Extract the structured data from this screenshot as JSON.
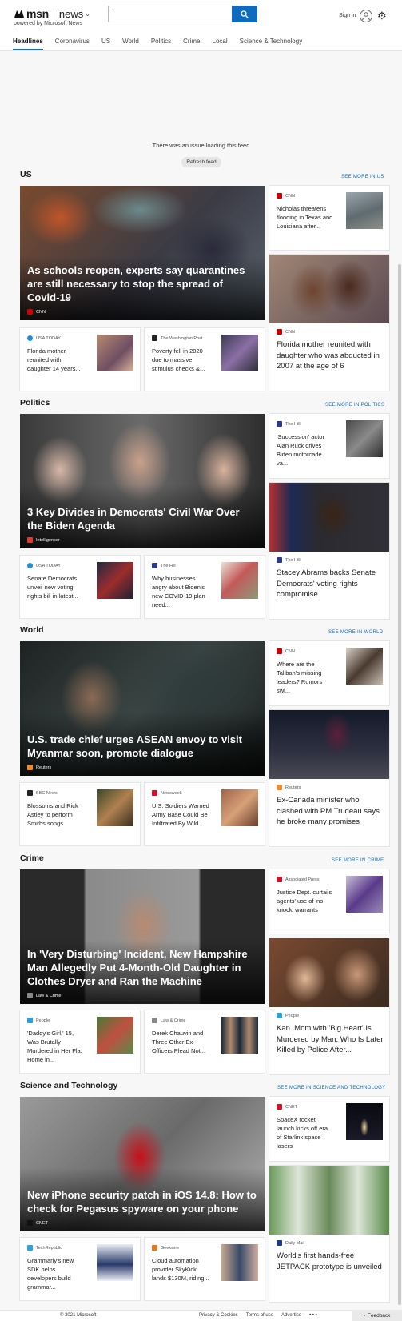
{
  "header": {
    "brand": "msn",
    "section": "news",
    "powered_by": "powered by Microsoft News",
    "search_placeholder": "",
    "signin_label": "Sign in"
  },
  "nav": {
    "tabs": [
      "Headlines",
      "Coronavirus",
      "US",
      "World",
      "Politics",
      "Crime",
      "Local",
      "Science & Technology"
    ],
    "active": "Headlines"
  },
  "feed": {
    "error_message": "There was an issue loading this feed",
    "refresh_label": "Refresh feed"
  },
  "sections": {
    "us": {
      "title": "US",
      "see_more": "SEE MORE IN US",
      "hero": {
        "title": "As schools reopen, experts say quarantines are still necessary to stop the spread of Covid-19",
        "source": "CNN"
      },
      "small1": {
        "source": "USA TODAY",
        "title": "Florida mother reunited with daughter 14 years..."
      },
      "small2": {
        "source": "The Washington Post",
        "title": "Poverty fell in 2020 due to massive stimulus checks &..."
      },
      "side1": {
        "source": "CNN",
        "title": "Nicholas threatens flooding in Texas and Louisiana after..."
      },
      "tall": {
        "source": "CNN",
        "title": "Florida mother reunited with daughter who was abducted in 2007 at the age of 6"
      }
    },
    "politics": {
      "title": "Politics",
      "see_more": "SEE MORE IN POLITICS",
      "hero": {
        "title": "3 Key Divides in Democrats' Civil War Over the Biden Agenda",
        "source": "Intelligencer"
      },
      "small1": {
        "source": "USA TODAY",
        "title": "Senate Democrats unveil new voting rights bill in latest..."
      },
      "small2": {
        "source": "The Hill",
        "title": "Why businesses angry about Biden's new COVID-19 plan need..."
      },
      "side1": {
        "source": "The Hill",
        "title": "'Succession' actor Alan Ruck drives Biden motorcade va..."
      },
      "tall": {
        "source": "The Hill",
        "title": "Stacey Abrams backs Senate Democrats' voting rights compromise"
      }
    },
    "world": {
      "title": "World",
      "see_more": "SEE MORE IN WORLD",
      "hero": {
        "title": "U.S. trade chief urges ASEAN envoy to visit Myanmar soon, promote dialogue",
        "source": "Reuters"
      },
      "small1": {
        "source": "BBC News",
        "title": "Blossoms and Rick Astley to perform Smiths songs"
      },
      "small2": {
        "source": "Newsweek",
        "title": "U.S. Soldiers Warned Army Base Could Be Infiltrated By Wild..."
      },
      "side1": {
        "source": "CNN",
        "title": "Where are the Taliban's missing leaders? Rumors swi..."
      },
      "tall": {
        "source": "Reuters",
        "title": "Ex-Canada minister who clashed with PM Trudeau says he broke many promises"
      }
    },
    "crime": {
      "title": "Crime",
      "see_more": "SEE MORE IN CRIME",
      "hero": {
        "title": "In 'Very Disturbing' Incident, New Hampshire Man Allegedly Put 4-Month-Old Daughter in Clothes Dryer and Ran the Machine",
        "source": "Law & Crime"
      },
      "small1": {
        "source": "People",
        "title": "'Daddy's Girl,' 15, Was Brutally Murdered in Her Fla. Home in..."
      },
      "small2": {
        "source": "Law & Crime",
        "title": "Derek Chauvin and Three Other Ex-Officers Plead Not..."
      },
      "side1": {
        "source": "Associated Press",
        "title": "Justice Dept. curtails agents' use of 'no-knock' warrants"
      },
      "tall": {
        "source": "People",
        "title": "Kan. Mom with 'Big Heart' Is Murdered by Man, Who Is Later Killed by Police After..."
      }
    },
    "scitech": {
      "title": "Science and Technology",
      "see_more": "SEE MORE IN SCIENCE AND TECHNOLOGY",
      "hero": {
        "title": "New iPhone security patch in iOS 14.8: How to check for Pegasus spyware on your phone",
        "source": "CNET"
      },
      "small1": {
        "source": "TechRepublic",
        "title": "Grammarly's new SDK helps developers build grammar..."
      },
      "small2": {
        "source": "Geekwire",
        "title": "Cloud automation provider SkyKick lands $130M, riding..."
      },
      "side1": {
        "source": "CNET",
        "title": "SpaceX rocket launch kicks off era of Starlink space lasers"
      },
      "tall": {
        "source": "Daily Mail",
        "title": "World's first hands-free JETPACK prototype is unveiled"
      }
    }
  },
  "footer": {
    "copyright": "© 2021 Microsoft",
    "links": [
      "Privacy & Cookies",
      "Terms of use",
      "Advertise"
    ],
    "more": "• • •",
    "feedback": "Feedback"
  },
  "colors": {
    "accent": "#0f6cbd",
    "cnn": "#cc0000",
    "usatoday": "#1e8fd8",
    "wapo": "#222222",
    "thehill": "#2b3a8a"
  }
}
